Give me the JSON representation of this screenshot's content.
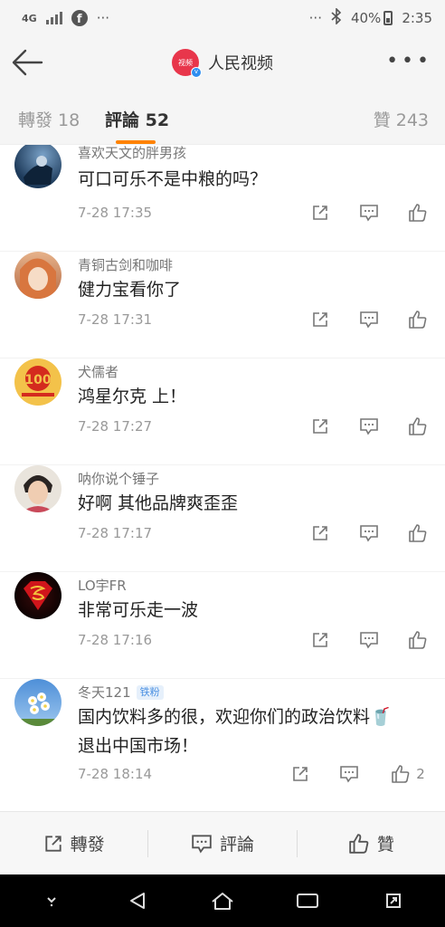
{
  "status_bar": {
    "network": "4G",
    "dots_left": "···",
    "dots_right": "···",
    "battery": "40%",
    "time": "2:35"
  },
  "header": {
    "channel_name": "人民视频",
    "logo_text": "视频"
  },
  "tabs": {
    "forward": "轉發 18",
    "comments": "評論 52",
    "likes": "贊 243"
  },
  "comments": [
    {
      "user": "喜欢天文的胖男孩",
      "text": "可口可乐不是中粮的吗？",
      "time": "7-28 17:35",
      "like_count": ""
    },
    {
      "user": "青铜古剑和咖啡",
      "text": "健力宝看你了",
      "time": "7-28 17:31",
      "like_count": ""
    },
    {
      "user": "犬儒者",
      "text": "鸿星尔克 上！",
      "time": "7-28 17:27",
      "like_count": ""
    },
    {
      "user": "呐你说个锤子",
      "text": "好啊 其他品牌爽歪歪",
      "time": "7-28 17:17",
      "like_count": ""
    },
    {
      "user": "LO宇FR",
      "text": "非常可乐走一波",
      "time": "7-28 17:16",
      "like_count": ""
    },
    {
      "user": "冬天121",
      "badge": "铁粉",
      "text_line1": "国内饮料多的很，欢迎你们的政治饮料🥤",
      "text_line2": "退出中国市场！",
      "time": "7-28 18:14",
      "like_count": "2"
    }
  ],
  "bottom_bar": {
    "forward": "轉發",
    "comment": "評論",
    "like": "贊"
  },
  "colors": {
    "accent": "#ff8200",
    "brand_red": "#e8364b",
    "verified_blue": "#2f8ef0"
  }
}
